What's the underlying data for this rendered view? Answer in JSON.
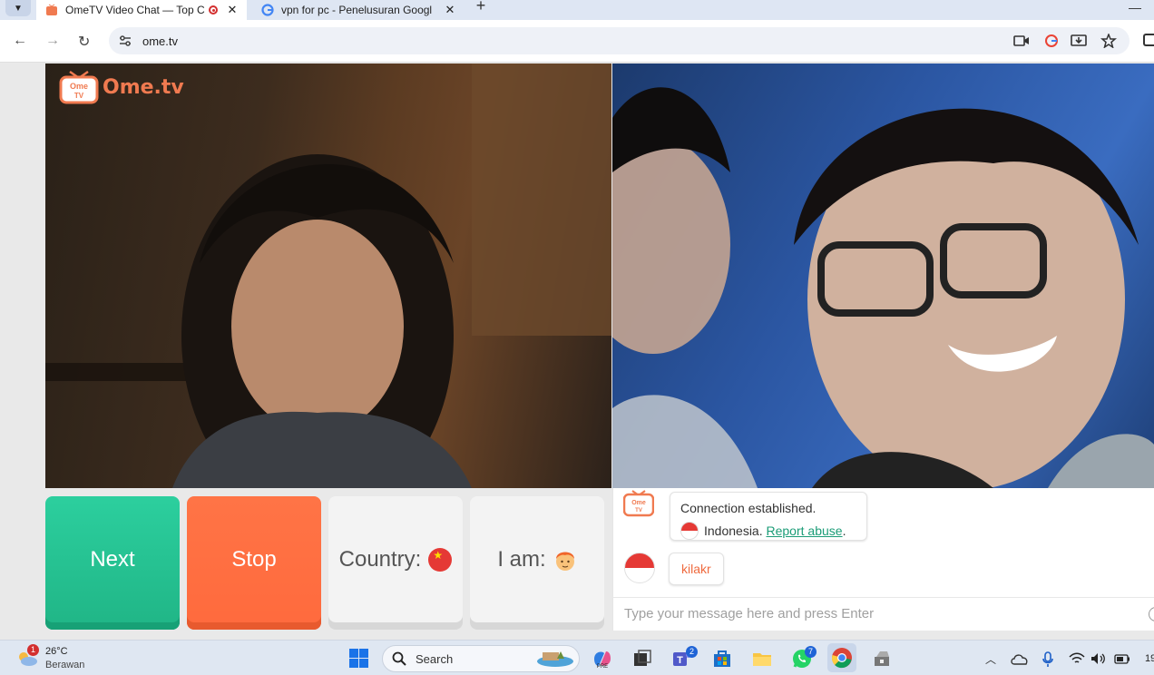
{
  "browser": {
    "tabs": [
      {
        "title": "OmeTV Video Chat — Top C",
        "active": true
      },
      {
        "title": "vpn for pc - Penelusuran Googl",
        "active": false
      }
    ],
    "new_tab_label": "+",
    "url": "ome.tv",
    "minimize_label": "—"
  },
  "site": {
    "logo_text": "Ome.tv",
    "logo_badge": "Ome TV"
  },
  "controls": {
    "next_label": "Next",
    "stop_label": "Stop",
    "country_label": "Country:",
    "country_flag": "China",
    "iam_label": "I am:"
  },
  "chat": {
    "system_line1": "Connection established.",
    "country": "Indonesia.",
    "report_link": "Report abuse",
    "report_suffix": ".",
    "partner_name": "kilakr",
    "input_placeholder": "Type your message here and press Enter"
  },
  "taskbar": {
    "weather_badge": "1",
    "temperature": "26°C",
    "condition": "Berawan",
    "search_text": "Search",
    "teams_badge": "2",
    "whatsapp_badge": "7",
    "clock": "19"
  },
  "colors": {
    "next": "#22c08f",
    "stop": "#ff6e40",
    "accent": "#f07a50",
    "link": "#1b9c77"
  }
}
